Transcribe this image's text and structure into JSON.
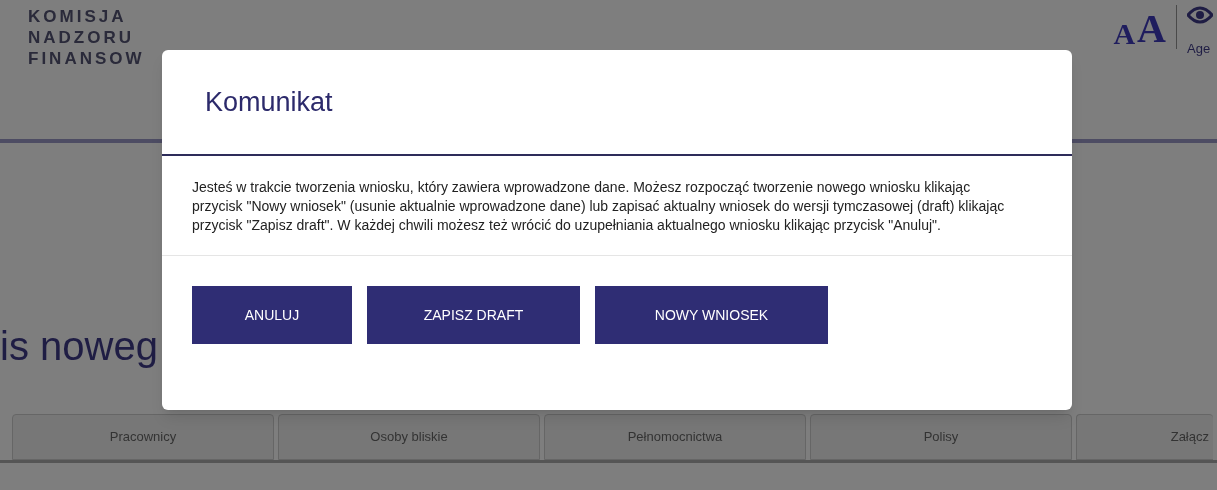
{
  "header": {
    "logo_lines": [
      "KOMISJA",
      "NADZORU",
      "FINANSOW"
    ],
    "font_size_options": [
      "A",
      "A"
    ],
    "accessibility_label": "Age"
  },
  "page": {
    "heading": "is noweg"
  },
  "tabs": [
    {
      "label": "Pracownicy"
    },
    {
      "label": "Osoby bliskie"
    },
    {
      "label": "Pełnomocnictwa"
    },
    {
      "label": "Polisy"
    },
    {
      "label": "Załącz"
    }
  ],
  "dialog": {
    "title": "Komunikat",
    "message": "Jesteś w trakcie tworzenia wniosku, który zawiera wprowadzone dane. Możesz rozpocząć tworzenie nowego wniosku klikając przycisk \"Nowy wniosek\" (usunie aktualnie wprowadzone dane) lub zapisać aktualny wniosek do wersji tymczasowej (draft) klikając przycisk \"Zapisz draft\". W każdej chwili możesz też wrócić do uzupełniania aktualnego wniosku klikając przycisk \"Anuluj\".",
    "buttons": [
      "ANULUJ",
      "ZAPISZ DRAFT",
      "NOWY WNIOSEK"
    ]
  }
}
